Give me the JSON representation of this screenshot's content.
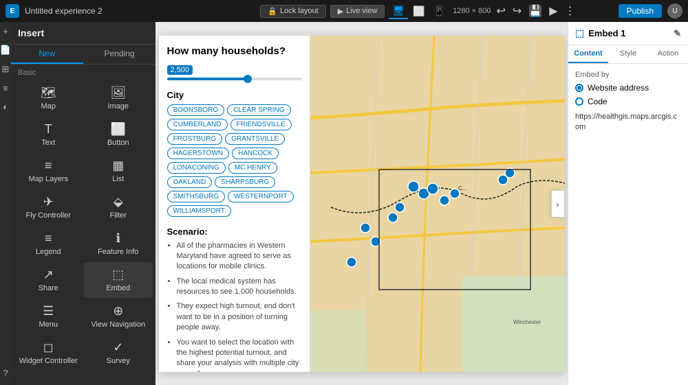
{
  "topbar": {
    "logo": "E",
    "title": "Untitled experience 2",
    "lock_layout_label": "Lock layout",
    "live_view_label": "Live view",
    "size_label": "1280 × 800",
    "publish_label": "Publish",
    "avatar_initials": "U"
  },
  "left_panel": {
    "header_label": "Insert",
    "tab_new": "New",
    "tab_pending": "Pending",
    "section_basic": "Basic",
    "widgets": [
      {
        "name": "map",
        "label": "Map",
        "icon": "🗺"
      },
      {
        "name": "image",
        "label": "Image",
        "icon": "🖼"
      },
      {
        "name": "text",
        "label": "Text",
        "icon": "T"
      },
      {
        "name": "button",
        "label": "Button",
        "icon": "⬜"
      },
      {
        "name": "map-layers",
        "label": "Map Layers",
        "icon": "≡"
      },
      {
        "name": "list",
        "label": "List",
        "icon": "▦"
      },
      {
        "name": "fly-controller",
        "label": "Fly Controller",
        "icon": "✈"
      },
      {
        "name": "filter",
        "label": "Filter",
        "icon": "⬙"
      },
      {
        "name": "legend",
        "label": "Legend",
        "icon": "≡"
      },
      {
        "name": "feature-info",
        "label": "Feature Info",
        "icon": "ℹ"
      },
      {
        "name": "share",
        "label": "Share",
        "icon": "↗"
      },
      {
        "name": "embed",
        "label": "Embed",
        "icon": "⬚"
      },
      {
        "name": "menu",
        "label": "Menu",
        "icon": "☰"
      },
      {
        "name": "view-navigation",
        "label": "View Navigation",
        "icon": "⊕"
      },
      {
        "name": "widget-controller",
        "label": "Widget Controller",
        "icon": "◻"
      },
      {
        "name": "survey",
        "label": "Survey",
        "icon": "✓"
      }
    ]
  },
  "canvas": {
    "filter_title": "How many households?",
    "slider_value": "2,500",
    "city_label": "City",
    "cities": [
      "BOONSBORO",
      "CLEAR SPRING",
      "CUMBERLAND",
      "FRIENDSVILLE",
      "FROSTBURG",
      "GRANTSVILLE",
      "HAGERSTOWN",
      "HANCOCK",
      "LONACONING",
      "MC HENRY",
      "OAKLAND",
      "SHARPSBURG",
      "SMITHSBURG",
      "WESTERNPORT",
      "WILLIAMSPORT"
    ],
    "scenario_label": "Scenario:",
    "scenario_items": [
      "All of the pharmacies in Western Maryland have agreed to serve as locations for mobile clinics.",
      "The local medical system has resources to see 1,000 households.",
      "They expect high turnout, end don't want to be in a position of turning people away.",
      "You want to select the location with the highest potential turnout, and share your analysis with multiple city councils."
    ]
  },
  "right_panel": {
    "icon": "⬚",
    "title": "Embed 1",
    "tabs": [
      "Content",
      "Style",
      "Action"
    ],
    "active_tab": "Content",
    "embed_by_label": "Embed by",
    "option_website": "Website address",
    "option_code": "Code",
    "embed_url": "https://healthgis.maps.arcgis.com"
  }
}
